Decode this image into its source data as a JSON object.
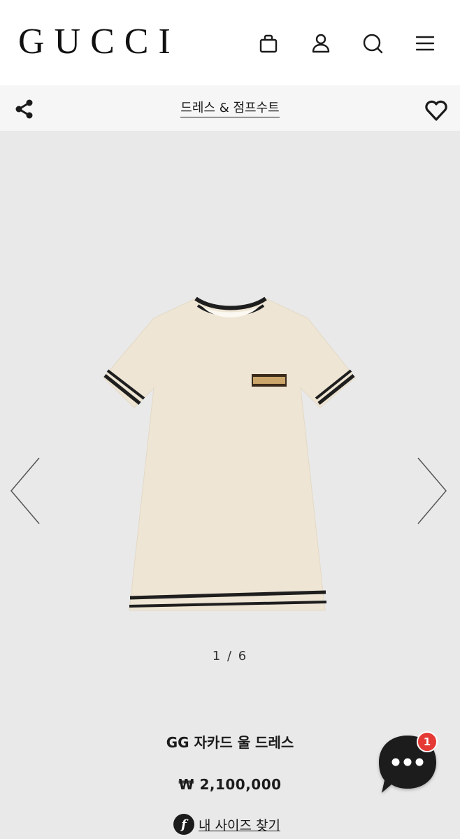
{
  "header": {
    "logo": "GUCCI",
    "icons": [
      "shopping-bag-icon",
      "user-icon",
      "search-icon",
      "menu-icon"
    ]
  },
  "subheader": {
    "category": "드레스 & 점프수트",
    "icons": [
      "share-icon",
      "heart-icon"
    ]
  },
  "gallery": {
    "pager": "1 / 6",
    "icons": [
      "chevron-left-icon",
      "chevron-right-icon"
    ]
  },
  "product": {
    "name": "GG 자카드 울 드레스",
    "price": "₩ 2,100,000",
    "size_link_icon": "f",
    "size_link": "내 사이즈 찾기"
  },
  "chat": {
    "badge_count": "1",
    "icon": "chat-icon"
  },
  "colors": {
    "badge": "#e53935",
    "gallery_bg": "#e9e9e9",
    "dress": "#eee5d4"
  }
}
